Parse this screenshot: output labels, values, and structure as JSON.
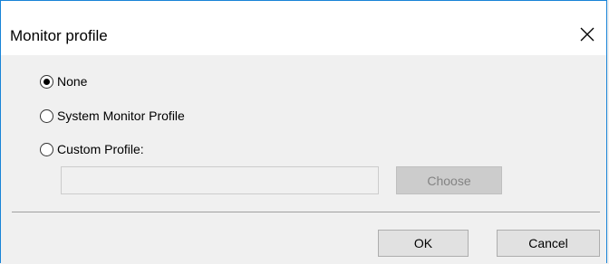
{
  "dialog": {
    "title": "Monitor profile",
    "close_icon": "close-icon"
  },
  "options": {
    "none_label": "None",
    "system_label": "System Monitor Profile",
    "custom_label": "Custom Profile:",
    "selected": "None"
  },
  "custom_profile": {
    "path_value": "",
    "choose_label": "Choose"
  },
  "footer": {
    "ok_label": "OK",
    "cancel_label": "Cancel"
  },
  "colors": {
    "window_border": "#1883d7",
    "background": "#f0f0f0",
    "disabled_button": "#cccccc"
  }
}
